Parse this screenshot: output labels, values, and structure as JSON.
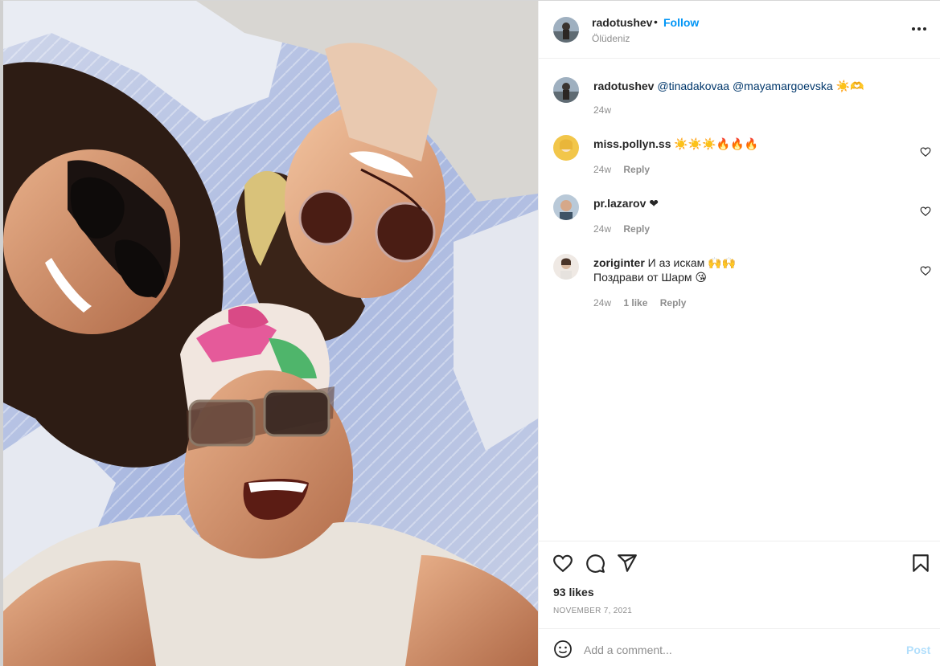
{
  "post": {
    "author": "radotushev",
    "follow_label": "Follow",
    "dot": "•",
    "location": "Ölüdeniz",
    "more_label": "···"
  },
  "caption": {
    "username": "radotushev",
    "mention_1": "@tinadakovaa",
    "mention_2": "@mayamargoevska",
    "tail": "☀️🫶",
    "time": "24w"
  },
  "comments": [
    {
      "username": "miss.pollyn.ss",
      "text": "☀️☀️☀️🔥🔥🔥",
      "time": "24w",
      "likes": "",
      "reply": "Reply"
    },
    {
      "username": "pr.lazarov",
      "text": "❤",
      "time": "24w",
      "likes": "",
      "reply": "Reply"
    },
    {
      "username": "zoriginter",
      "text": "И аз искам 🙌🙌",
      "text2": "Поздрави от Шарм 😘",
      "time": "24w",
      "likes": "1 like",
      "reply": "Reply"
    }
  ],
  "actions": {
    "likes": "93 likes",
    "date": "November 7, 2021",
    "icons": [
      "heart-icon",
      "comment-icon",
      "share-icon",
      "bookmark-icon"
    ]
  },
  "add_comment": {
    "placeholder": "Add a comment...",
    "post_label": "Post"
  },
  "colors": {
    "accent": "#0095f6",
    "post_disabled": "#b2dffc",
    "muted": "#8e8e8e",
    "text": "#262626"
  }
}
